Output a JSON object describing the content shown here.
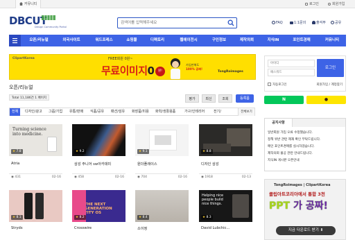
{
  "topbar": {
    "community": "커뮤니티",
    "login": "로그인",
    "signup": "회원가입"
  },
  "logo": {
    "word": "DBCUT",
    "tagline": "Design Community Portal"
  },
  "search": {
    "placeholder": "검색어를 입력해주세요"
  },
  "header_links": {
    "faq": "FAQ",
    "qa": "1:1문의",
    "attendance": "출석부",
    "share": "공유"
  },
  "nav": {
    "items": [
      "오픈/리뉴얼",
      "외국사이트",
      "워드프레스",
      "쇼핑몰",
      "디렉토리",
      "웹에이전시",
      "구인정보",
      "제작의뢰",
      "지식IN",
      "포인트경매",
      "커뮤니티"
    ]
  },
  "ad_top": {
    "brand": "ClipartKorea",
    "free_text": "FREE회원 0원~",
    "headline": "무료이미지",
    "zero": "0",
    "won": "원!",
    "mid_line1": "가입만해도",
    "mid_line2": "100% 공짜!",
    "tongro": "TongRoimages"
  },
  "section": {
    "title": "오픈/리뉴얼",
    "total": "Total 11,186건 1 페이지"
  },
  "sort_buttons": [
    "평가",
    "최신",
    "조회"
  ],
  "register_button": "등록폼",
  "categories": {
    "items": [
      "전체",
      "디자인/광고",
      "그룹/기업",
      "유통/판매",
      "식품/공유",
      "패션/섬유",
      "화장품/미용",
      "화학/생활용품",
      "가구/인테리어",
      "전기/"
    ],
    "more": "전체보기"
  },
  "cards": [
    {
      "title": "Atria",
      "rating": "7.8",
      "views": "431",
      "date": "02-16"
    },
    {
      "title": "삼성 주니어 sw아카데미",
      "rating": "9.2",
      "views": "458",
      "date": "02-16"
    },
    {
      "title": "원더플레이스",
      "rating": "9.1",
      "views": "704",
      "date": "02-16"
    },
    {
      "title": "디자인 삼성",
      "rating": "8.8",
      "views": "1918",
      "date": "02-13"
    },
    {
      "title": "Stryds",
      "rating": "8.1",
      "views": "",
      "date": ""
    },
    {
      "title": "Crosswire",
      "rating": "8.2",
      "views": "",
      "date": ""
    },
    {
      "title": "소이정",
      "rating": "8.4",
      "views": "",
      "date": ""
    },
    {
      "title": "David Lubchic...",
      "rating": "8.3",
      "views": "",
      "date": ""
    }
  ],
  "thumbs": {
    "card1_text": "Turning science into medicine.",
    "card6_text": "THE NEXT GENERATION TITY OS",
    "card8_text": "Helping nice people build nice things."
  },
  "login_box": {
    "id_placeholder": "아이디",
    "pw_placeholder": "패스워드",
    "button": "로그인",
    "keep": "자동로그인",
    "signup": "회원가입",
    "find": "계정찾기"
  },
  "sns": {
    "naver": "N",
    "kakao": "●"
  },
  "notice": {
    "tabs": [
      "공지사항",
      ""
    ],
    "lines": [
      "일반회원 가입 오류 수정했습니다.",
      "정책 위반 관련 제재 확인 부탁드립니다.",
      "메인 포인트경매를 실시하겠습니다.",
      "제작의뢰 불공 관련 안내드립니다.",
      "지식IN 게시판 오픈안내"
    ]
  },
  "ad_side": {
    "head": "TongRoimages | ClipartKorea",
    "line1": "클립아트코리아에서 통합 3천",
    "line2a": "PPT",
    "line2b": "가 공짜!",
    "button": "지금 다운로드 받기"
  },
  "colors": {
    "primary": "#3d63e6",
    "logo": "#1f3c88",
    "ad_yellow": "#ffdf00",
    "naver": "#03c75a",
    "kakao": "#fee500"
  }
}
